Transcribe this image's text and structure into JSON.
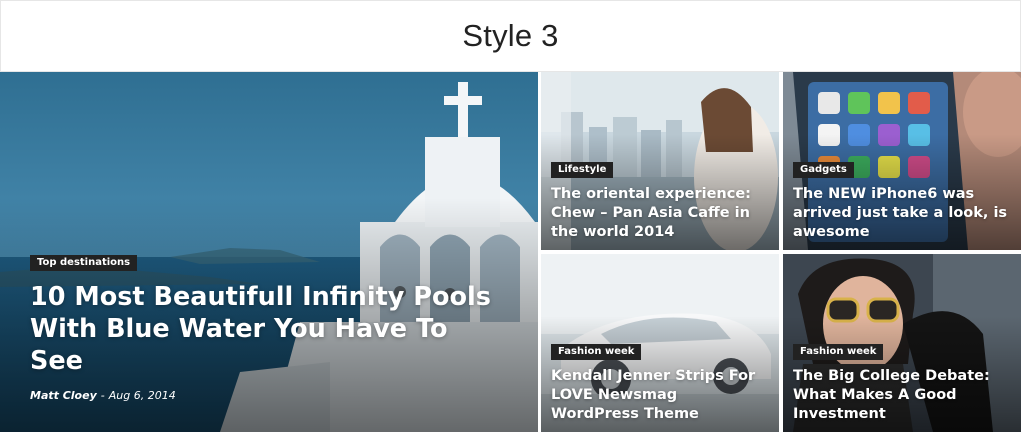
{
  "header": {
    "title": "Style 3"
  },
  "featured": {
    "category": "Top destinations",
    "title": "10 Most Beautifull Infinity Pools With Blue Water You Have To See",
    "author": "Matt Cloey",
    "separator": "-",
    "date": "Aug 6, 2014"
  },
  "posts": [
    {
      "category": "Lifestyle",
      "title": "The oriental experience: Chew – Pan Asia Caffe in the world 2014"
    },
    {
      "category": "Gadgets",
      "title": "The NEW iPhone6 was arrived just take a look, is awesome"
    },
    {
      "category": "Fashion week",
      "title": "Kendall Jenner Strips For LOVE Newsmag WordPress Theme"
    },
    {
      "category": "Fashion week",
      "title": "The Big College Debate: What Makes A Good Investment"
    }
  ],
  "colors": {
    "category_badge": "#222222",
    "overlay_text": "#ffffff"
  }
}
